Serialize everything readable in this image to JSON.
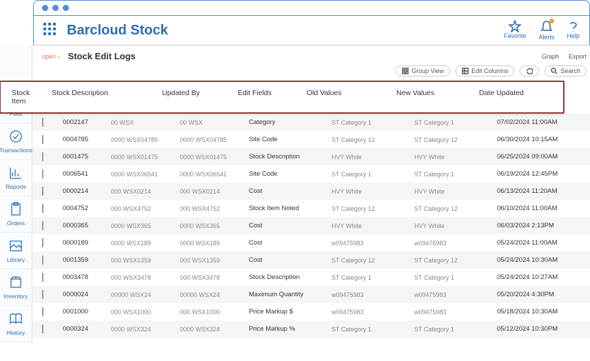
{
  "app": {
    "title": "Barcloud Stock"
  },
  "header_icons": {
    "favorite": "Favorite",
    "alerts": "Alerts",
    "help": "Help"
  },
  "breadcrumb": "open  ›",
  "page_title": "Stock Edit Logs",
  "subheader_links": {
    "graph": "Graph",
    "export": "Export"
  },
  "toolbar": {
    "group_view": "Group View",
    "edit_columns": "Edit Columns",
    "refresh": "",
    "search": "Search"
  },
  "sidebar": [
    {
      "label": "Files"
    },
    {
      "label": "Transactions"
    },
    {
      "label": "Reports"
    },
    {
      "label": "Orders"
    },
    {
      "label": "Library"
    },
    {
      "label": "Inventory"
    },
    {
      "label": "History"
    }
  ],
  "columns": {
    "stock_item": "Stock Item",
    "stock_description": "Stock Description",
    "updated_by": "Updated By",
    "edit_fields": "Edit Fields",
    "old_values": "Old Values",
    "new_values": "New Values",
    "date_updated": "Date Updated"
  },
  "rows": [
    {
      "stock": "0002147",
      "desc": "00 WSX",
      "by": "00 WSX",
      "field": "Category",
      "old": "ST Category 1",
      "new": "ST Category 1",
      "date": "07/02/2024 11:00AM"
    },
    {
      "stock": "0004785",
      "desc": "0000 WSX04785",
      "by": "0000 WSX04785",
      "field": "Site Code",
      "old": "ST Category 12",
      "new": "ST Category 12",
      "date": "06/30/2024 10:15AM"
    },
    {
      "stock": "0001475",
      "desc": "0000 WSX01475",
      "by": "0000 WSX01475",
      "field": "Stock Description",
      "old": "HVY White",
      "new": "HVY White",
      "date": "06/25/2024 09:00AM"
    },
    {
      "stock": "0006541",
      "desc": "0000 WSX06541",
      "by": "0000 WSX06541",
      "field": "Site Code",
      "old": "ST Category 1",
      "new": "ST Category 1",
      "date": "06/19/2024 12:45PM"
    },
    {
      "stock": "0000214",
      "desc": "000 WSX0214",
      "by": "000 WSX0214",
      "field": "Cost",
      "old": "HVY White",
      "new": "HVY White",
      "date": "06/13/2024 11:20AM"
    },
    {
      "stock": "0004752",
      "desc": "000 WSX4752",
      "by": "000 WSX4752",
      "field": "Stock Item Noted",
      "old": "ST Category 12",
      "new": "ST Category 12",
      "date": "06/10/2024 11:00AM"
    },
    {
      "stock": "0000365",
      "desc": "0000 WSX365",
      "by": "0000 WSX365",
      "field": "Cost",
      "old": "HVY White",
      "new": "HVY White",
      "date": "06/03/2024 2:13PM"
    },
    {
      "stock": "0000189",
      "desc": "0000 WSX189",
      "by": "0000 WSX189",
      "field": "Cost",
      "old": "w09475983",
      "new": "w09475983",
      "date": "05/24/2024 11:00AM"
    },
    {
      "stock": "0001359",
      "desc": "000 WSX1359",
      "by": "000 WSX1359",
      "field": "Cost",
      "old": "ST Category 12",
      "new": "ST Category 12",
      "date": "05/24/2024 10:30AM"
    },
    {
      "stock": "0003478",
      "desc": "000 WSX3478",
      "by": "000 WSX3478",
      "field": "Stock Description",
      "old": "ST Category 1",
      "new": "ST Category 1",
      "date": "05/24/2024 10:27AM"
    },
    {
      "stock": "0000024",
      "desc": "00000 WSX24",
      "by": "00000 WSX24",
      "field": "Maximum Quantity",
      "old": "w09475983",
      "new": "w09475983",
      "date": "05/20/2024 4:30PM"
    },
    {
      "stock": "0001000",
      "desc": "000 WSX1000",
      "by": "000 WSX1000",
      "field": "Price Markup $",
      "old": "w09475983",
      "new": "w09475983",
      "date": "05/18/2024 10:30AM"
    },
    {
      "stock": "0000324",
      "desc": "0000 WSX324",
      "by": "0000 WSX324",
      "field": "Price Markup %",
      "old": "ST Category 1",
      "new": "ST Category 1",
      "date": "05/12/2024 10:30PM"
    }
  ]
}
